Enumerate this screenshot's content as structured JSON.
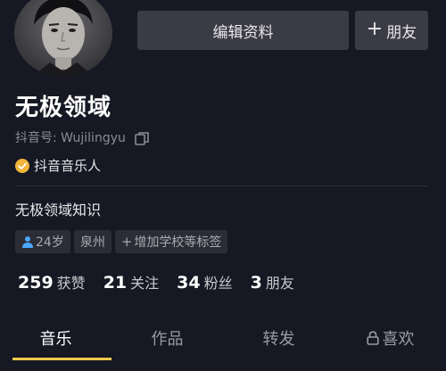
{
  "profile": {
    "name": "无极领域",
    "douyin_id": "抖音号: Wujilingyu",
    "verified_label": "抖音音乐人",
    "bio": "无极领域知识"
  },
  "buttons": {
    "edit_profile": "编辑资料",
    "add_friend": "朋友",
    "add_friend_plus": "+"
  },
  "tags": {
    "age": "24岁",
    "location": "泉州",
    "add_school": "增加学校等标签",
    "add_school_plus": "+"
  },
  "stats": [
    {
      "num": "259",
      "label": "获赞"
    },
    {
      "num": "21",
      "label": "关注"
    },
    {
      "num": "34",
      "label": "粉丝"
    },
    {
      "num": "3",
      "label": "朋友"
    }
  ],
  "tabs": [
    {
      "label": "音乐"
    },
    {
      "label": "作品"
    },
    {
      "label": "转发"
    },
    {
      "label": "喜欢"
    }
  ],
  "colors": {
    "background": "#161823",
    "accent": "#f2c94c",
    "verify_badge": "#f2b53a",
    "age_icon": "#4aa8ff"
  },
  "icons": {
    "copy": "copy-icon",
    "verify": "verified-badge-icon",
    "person": "person-icon",
    "lock": "lock-icon"
  }
}
